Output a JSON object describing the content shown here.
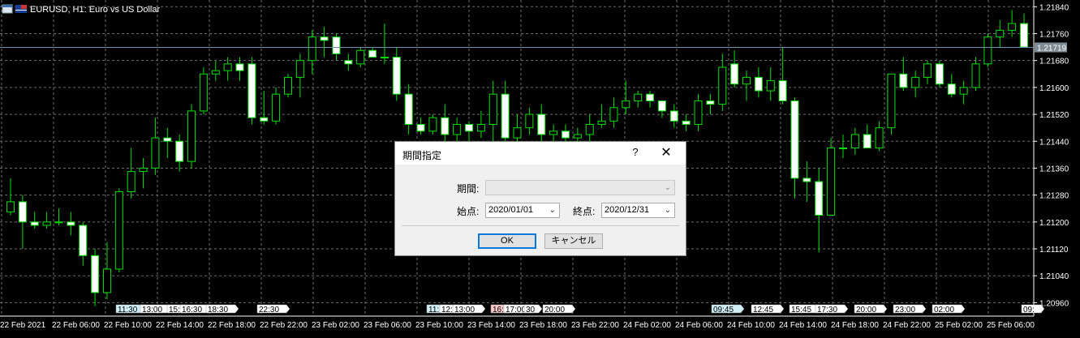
{
  "chart_header": {
    "symbol_text": "EURUSD, H1:  Euro vs US Dollar",
    "icons": [
      "window-icon",
      "flag-icon"
    ]
  },
  "price_axis": {
    "labels": [
      "1.21840",
      "1.21760",
      "1.21680",
      "1.21600",
      "1.21520",
      "1.21440",
      "1.21360",
      "1.21280",
      "1.21200",
      "1.21120",
      "1.21040",
      "1.20960"
    ],
    "current_price": "1.21719"
  },
  "time_axis": {
    "labels": [
      "22 Feb 2021",
      "22 Feb 06:00",
      "22 Feb 10:00",
      "22 Feb 14:00",
      "22 Feb 18:00",
      "22 Feb 22:00",
      "23 Feb 02:00",
      "23 Feb 06:00",
      "23 Feb 10:00",
      "23 Feb 14:00",
      "23 Feb 18:00",
      "23 Feb 22:00",
      "24 Feb 02:00",
      "24 Feb 06:00",
      "24 Feb 10:00",
      "24 Feb 14:00",
      "24 Feb 18:00",
      "24 Feb 22:00",
      "25 Feb 02:00",
      "25 Feb 06:00"
    ]
  },
  "event_markers": [
    {
      "text": "11:30",
      "color": "#cfeef5"
    },
    {
      "text": "13:00",
      "color": "#ffffff"
    },
    {
      "text": "15:",
      "color": "#ffffff"
    },
    {
      "text": "16:30",
      "color": "#ffffff"
    },
    {
      "text": "18:30",
      "color": "#ffffff"
    },
    {
      "text": "22:30",
      "color": "#ffffff"
    },
    {
      "text": "11:",
      "color": "#cfeef5"
    },
    {
      "text": "12:",
      "color": "#ffffff"
    },
    {
      "text": "13:00",
      "color": "#ffffff"
    },
    {
      "text": "16:",
      "color": "#f7c9c9"
    },
    {
      "text": "17:00",
      "color": "#ffffff"
    },
    {
      "text": "30",
      "color": "#ffffff"
    },
    {
      "text": "20:00",
      "color": "#ffffff"
    },
    {
      "text": "09:45",
      "color": "#cfeef5"
    },
    {
      "text": "12:45",
      "color": "#ffffff"
    },
    {
      "text": "15:45",
      "color": "#ffffff"
    },
    {
      "text": "17:30",
      "color": "#ffffff"
    },
    {
      "text": "20:00",
      "color": "#ffffff"
    },
    {
      "text": "23:00",
      "color": "#ffffff"
    },
    {
      "text": "02:00",
      "color": "#ffffff"
    },
    {
      "text": "09:",
      "color": "#ffffff"
    }
  ],
  "colors": {
    "background": "#000000",
    "grid": "#6e6e6e",
    "candle_up": "#000000",
    "candle_down": "#ffffff",
    "wick": "#00e000",
    "current_price_line": "#6f93a8"
  },
  "chart_data": {
    "type": "candlestick",
    "symbol": "EURUSD",
    "timeframe": "H1",
    "ylim": [
      1.2092,
      1.2186
    ],
    "candles": [
      {
        "o": 1.2123,
        "h": 1.2133,
        "l": 1.2122,
        "c": 1.2126
      },
      {
        "o": 1.2126,
        "h": 1.2128,
        "l": 1.2112,
        "c": 1.212
      },
      {
        "o": 1.212,
        "h": 1.2123,
        "l": 1.2118,
        "c": 1.2119
      },
      {
        "o": 1.2119,
        "h": 1.2123,
        "l": 1.2118,
        "c": 1.212
      },
      {
        "o": 1.212,
        "h": 1.2124,
        "l": 1.2119,
        "c": 1.212
      },
      {
        "o": 1.212,
        "h": 1.2123,
        "l": 1.2116,
        "c": 1.2119
      },
      {
        "o": 1.2119,
        "h": 1.212,
        "l": 1.2107,
        "c": 1.211
      },
      {
        "o": 1.211,
        "h": 1.2112,
        "l": 1.2095,
        "c": 1.2099
      },
      {
        "o": 1.2099,
        "h": 1.2114,
        "l": 1.2097,
        "c": 1.2106
      },
      {
        "o": 1.2106,
        "h": 1.213,
        "l": 1.2105,
        "c": 1.2129
      },
      {
        "o": 1.2129,
        "h": 1.2142,
        "l": 1.2127,
        "c": 1.2135
      },
      {
        "o": 1.2135,
        "h": 1.2139,
        "l": 1.213,
        "c": 1.2136
      },
      {
        "o": 1.2136,
        "h": 1.2151,
        "l": 1.2134,
        "c": 1.2145
      },
      {
        "o": 1.2145,
        "h": 1.2148,
        "l": 1.2139,
        "c": 1.2144
      },
      {
        "o": 1.2144,
        "h": 1.2146,
        "l": 1.2135,
        "c": 1.2138
      },
      {
        "o": 1.2138,
        "h": 1.2155,
        "l": 1.2136,
        "c": 1.2153
      },
      {
        "o": 1.2153,
        "h": 1.2166,
        "l": 1.2152,
        "c": 1.2164
      },
      {
        "o": 1.2164,
        "h": 1.2168,
        "l": 1.2162,
        "c": 1.2165
      },
      {
        "o": 1.2165,
        "h": 1.2169,
        "l": 1.2162,
        "c": 1.2167
      },
      {
        "o": 1.2167,
        "h": 1.2169,
        "l": 1.2162,
        "c": 1.2165
      },
      {
        "o": 1.2167,
        "h": 1.2169,
        "l": 1.2149,
        "c": 1.2151
      },
      {
        "o": 1.2151,
        "h": 1.2159,
        "l": 1.2149,
        "c": 1.215
      },
      {
        "o": 1.215,
        "h": 1.216,
        "l": 1.2149,
        "c": 1.2158
      },
      {
        "o": 1.2158,
        "h": 1.2164,
        "l": 1.2157,
        "c": 1.2163
      },
      {
        "o": 1.2163,
        "h": 1.217,
        "l": 1.2157,
        "c": 1.2168
      },
      {
        "o": 1.2168,
        "h": 1.2177,
        "l": 1.2164,
        "c": 1.2175
      },
      {
        "o": 1.2175,
        "h": 1.2178,
        "l": 1.2169,
        "c": 1.2174
      },
      {
        "o": 1.2175,
        "h": 1.2176,
        "l": 1.2168,
        "c": 1.217
      },
      {
        "o": 1.2168,
        "h": 1.217,
        "l": 1.2165,
        "c": 1.2167
      },
      {
        "o": 1.2167,
        "h": 1.2172,
        "l": 1.2166,
        "c": 1.2171
      },
      {
        "o": 1.2171,
        "h": 1.2172,
        "l": 1.2169,
        "c": 1.2169
      },
      {
        "o": 1.2169,
        "h": 1.2179,
        "l": 1.2167,
        "c": 1.2169
      },
      {
        "o": 1.2169,
        "h": 1.2172,
        "l": 1.2156,
        "c": 1.2158
      },
      {
        "o": 1.2158,
        "h": 1.2161,
        "l": 1.2146,
        "c": 1.2149
      },
      {
        "o": 1.2149,
        "h": 1.2151,
        "l": 1.2146,
        "c": 1.2147
      },
      {
        "o": 1.2147,
        "h": 1.2152,
        "l": 1.2146,
        "c": 1.2151
      },
      {
        "o": 1.2151,
        "h": 1.2155,
        "l": 1.2144,
        "c": 1.2146
      },
      {
        "o": 1.2146,
        "h": 1.2151,
        "l": 1.2143,
        "c": 1.2149
      },
      {
        "o": 1.2149,
        "h": 1.215,
        "l": 1.2144,
        "c": 1.2147
      },
      {
        "o": 1.2147,
        "h": 1.2153,
        "l": 1.2145,
        "c": 1.2149
      },
      {
        "o": 1.2149,
        "h": 1.2162,
        "l": 1.2144,
        "c": 1.2158
      },
      {
        "o": 1.2158,
        "h": 1.2162,
        "l": 1.2143,
        "c": 1.2145
      },
      {
        "o": 1.2145,
        "h": 1.2152,
        "l": 1.2143,
        "c": 1.2148
      },
      {
        "o": 1.2148,
        "h": 1.2154,
        "l": 1.2146,
        "c": 1.2152
      },
      {
        "o": 1.2152,
        "h": 1.2155,
        "l": 1.2143,
        "c": 1.2146
      },
      {
        "o": 1.2146,
        "h": 1.2149,
        "l": 1.2143,
        "c": 1.2147
      },
      {
        "o": 1.2147,
        "h": 1.2149,
        "l": 1.2143,
        "c": 1.2145
      },
      {
        "o": 1.2145,
        "h": 1.2148,
        "l": 1.2144,
        "c": 1.2146
      },
      {
        "o": 1.2146,
        "h": 1.2152,
        "l": 1.2144,
        "c": 1.2149
      },
      {
        "o": 1.2149,
        "h": 1.2155,
        "l": 1.2148,
        "c": 1.215
      },
      {
        "o": 1.215,
        "h": 1.2157,
        "l": 1.2148,
        "c": 1.2154
      },
      {
        "o": 1.2154,
        "h": 1.2162,
        "l": 1.2152,
        "c": 1.2156
      },
      {
        "o": 1.2156,
        "h": 1.2159,
        "l": 1.2154,
        "c": 1.2158
      },
      {
        "o": 1.2158,
        "h": 1.2159,
        "l": 1.2154,
        "c": 1.2156
      },
      {
        "o": 1.2156,
        "h": 1.2156,
        "l": 1.2151,
        "c": 1.2153
      },
      {
        "o": 1.2153,
        "h": 1.2155,
        "l": 1.2148,
        "c": 1.215
      },
      {
        "o": 1.215,
        "h": 1.2152,
        "l": 1.2147,
        "c": 1.2149
      },
      {
        "o": 1.2149,
        "h": 1.2158,
        "l": 1.2147,
        "c": 1.2156
      },
      {
        "o": 1.2156,
        "h": 1.2158,
        "l": 1.2152,
        "c": 1.2155
      },
      {
        "o": 1.2155,
        "h": 1.217,
        "l": 1.2153,
        "c": 1.2166
      },
      {
        "o": 1.2167,
        "h": 1.2171,
        "l": 1.216,
        "c": 1.2161
      },
      {
        "o": 1.2161,
        "h": 1.2165,
        "l": 1.2156,
        "c": 1.2163
      },
      {
        "o": 1.2163,
        "h": 1.2166,
        "l": 1.2157,
        "c": 1.2159
      },
      {
        "o": 1.2159,
        "h": 1.2166,
        "l": 1.2156,
        "c": 1.2162
      },
      {
        "o": 1.2162,
        "h": 1.2172,
        "l": 1.2155,
        "c": 1.2156
      },
      {
        "o": 1.2156,
        "h": 1.2157,
        "l": 1.2127,
        "c": 1.2133
      },
      {
        "o": 1.2133,
        "h": 1.2138,
        "l": 1.2126,
        "c": 1.2132
      },
      {
        "o": 1.2132,
        "h": 1.2136,
        "l": 1.2111,
        "c": 1.2122
      },
      {
        "o": 1.2122,
        "h": 1.2145,
        "l": 1.2122,
        "c": 1.2142
      },
      {
        "o": 1.2142,
        "h": 1.2146,
        "l": 1.2139,
        "c": 1.2142
      },
      {
        "o": 1.2142,
        "h": 1.2148,
        "l": 1.214,
        "c": 1.2146
      },
      {
        "o": 1.2146,
        "h": 1.2149,
        "l": 1.2142,
        "c": 1.2142
      },
      {
        "o": 1.2142,
        "h": 1.215,
        "l": 1.2141,
        "c": 1.2148
      },
      {
        "o": 1.2148,
        "h": 1.2164,
        "l": 1.2146,
        "c": 1.2164
      },
      {
        "o": 1.2164,
        "h": 1.2169,
        "l": 1.2159,
        "c": 1.216
      },
      {
        "o": 1.216,
        "h": 1.2165,
        "l": 1.2157,
        "c": 1.2163
      },
      {
        "o": 1.2163,
        "h": 1.2168,
        "l": 1.2161,
        "c": 1.2167
      },
      {
        "o": 1.2167,
        "h": 1.2168,
        "l": 1.216,
        "c": 1.2161
      },
      {
        "o": 1.2161,
        "h": 1.2164,
        "l": 1.2157,
        "c": 1.2158
      },
      {
        "o": 1.2158,
        "h": 1.2162,
        "l": 1.2155,
        "c": 1.216
      },
      {
        "o": 1.216,
        "h": 1.2169,
        "l": 1.2159,
        "c": 1.2167
      },
      {
        "o": 1.2167,
        "h": 1.2176,
        "l": 1.2166,
        "c": 1.2175
      },
      {
        "o": 1.2175,
        "h": 1.218,
        "l": 1.2172,
        "c": 1.2177
      },
      {
        "o": 1.2177,
        "h": 1.2183,
        "l": 1.2175,
        "c": 1.2179
      },
      {
        "o": 1.2179,
        "h": 1.2182,
        "l": 1.2172,
        "c": 1.2172
      }
    ]
  },
  "dialog": {
    "title": "期間指定",
    "help_label": "?",
    "close_label": "✕",
    "period_label": "期間:",
    "period_value": "",
    "start_label": "始点:",
    "start_value": "2020/01/01",
    "end_label": "終点:",
    "end_value": "2020/12/31",
    "ok_label": "OK",
    "cancel_label": "キャンセル"
  }
}
